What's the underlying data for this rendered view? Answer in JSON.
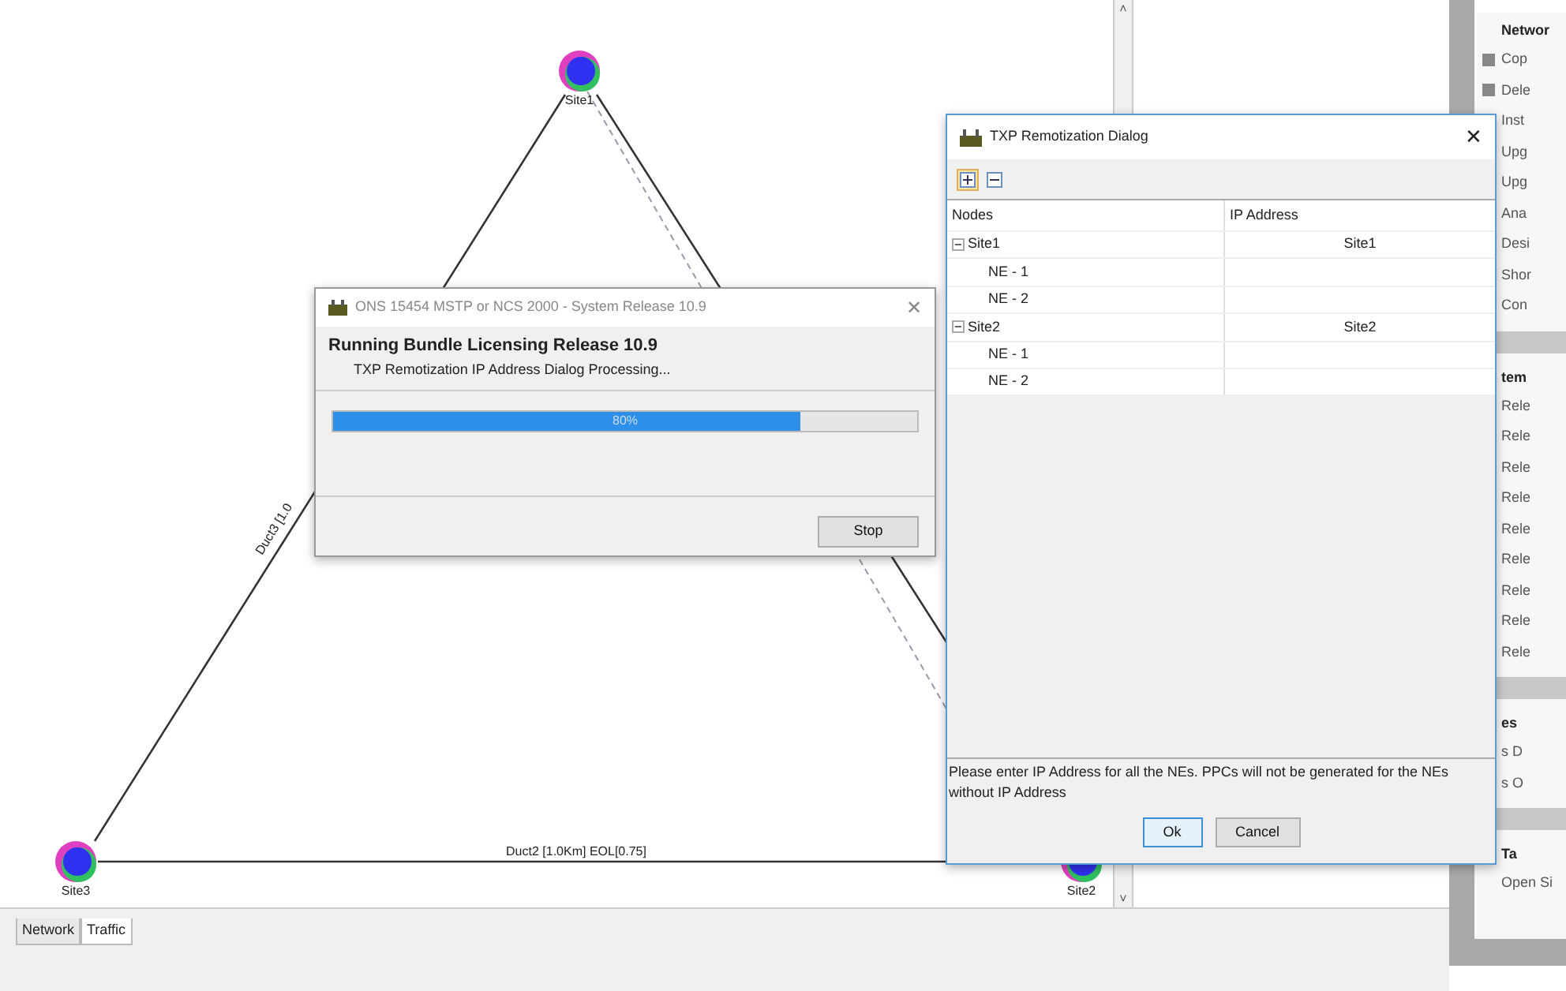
{
  "diagram": {
    "nodes": [
      {
        "label": "Site1"
      },
      {
        "label": "Site3"
      },
      {
        "label": "Site2"
      }
    ],
    "links": [
      {
        "label": "Duct3 [1.0"
      },
      {
        "label": "Duct2 [1.0Km] EOL[0.75]"
      }
    ]
  },
  "scrollbar": {
    "up_arrow": "˄",
    "down_arrow": "˅"
  },
  "side_panel": {
    "sections": [
      {
        "title": "Networ",
        "items": [
          "Cop",
          "Dele",
          "Inst",
          "Upg",
          "Upg",
          "Ana",
          "Desi",
          "Shor",
          "Con"
        ]
      },
      {
        "title": "tem",
        "items": [
          "Rele",
          "Rele",
          "Rele",
          "Rele",
          "Rele",
          "Rele",
          "Rele",
          "Rele",
          "Rele"
        ]
      },
      {
        "title": "es",
        "items": [
          "s D",
          "s O"
        ]
      },
      {
        "title": "Ta",
        "items": [
          "Open Si"
        ]
      }
    ]
  },
  "bottom_tabs": [
    {
      "label": "Network",
      "selected": false
    },
    {
      "label": "Traffic",
      "selected": true
    }
  ],
  "progress_dialog": {
    "title": "ONS 15454 MSTP or NCS 2000 - System Release 10.9",
    "close": "✕",
    "heading": "Running Bundle Licensing Release 10.9",
    "message": "TXP Remotization IP Address Dialog Processing...",
    "level": 0.8,
    "reading": "80%",
    "buttons": [
      "Stop"
    ]
  },
  "txp_dialog": {
    "title": "TXP Remotization Dialog",
    "close": "✕",
    "toolbar": [
      {
        "kind": "expand",
        "selected": true
      },
      {
        "kind": "collapse",
        "selected": false
      }
    ],
    "columns": [
      "Nodes",
      "IP Address"
    ],
    "rows": [
      {
        "label": "Site1",
        "ip": "Site1",
        "expanded": true,
        "children": [
          {
            "label": "NE - 1"
          },
          {
            "label": "NE - 2"
          }
        ]
      },
      {
        "label": "Site2",
        "ip": "Site2",
        "expanded": true,
        "children": [
          {
            "label": "NE - 1"
          },
          {
            "label": "NE - 2"
          }
        ]
      }
    ],
    "note": "Please enter IP Address for all the NEs. PPCs will not be generated for the NEs without IP Address",
    "buttons": [
      "Ok",
      "Cancel"
    ]
  }
}
